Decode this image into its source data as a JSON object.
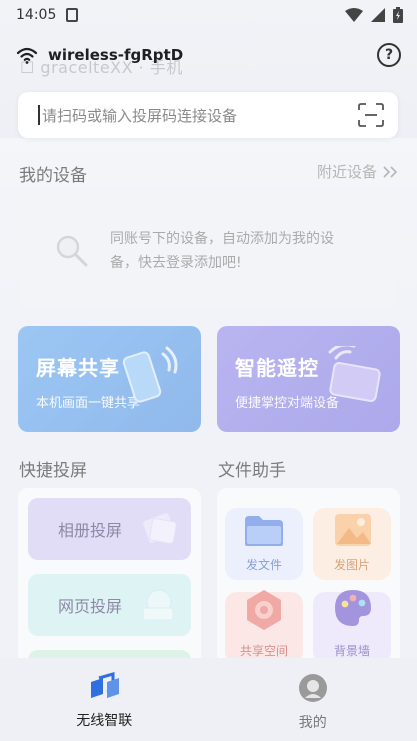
{
  "status_bar": {
    "time": "14:05"
  },
  "header": {
    "wifi_name": "wireless-fgRptD",
    "ghost_text": "☐ gracelteXX · 手机"
  },
  "search": {
    "placeholder": "请扫码或输入投屏码连接设备"
  },
  "my_devices": {
    "title": "我的设备",
    "nearby_label": "附近设备",
    "tip_line1": "同账号下的设备，自动添加为我的设备，",
    "tip_line2": "备，快去登录添加吧!"
  },
  "features": [
    {
      "title": "屏幕共享",
      "subtitle": "本机画面一键共享"
    },
    {
      "title": "智能遥控",
      "subtitle": "便捷掌控对端设备"
    }
  ],
  "quick_cast": {
    "title": "快捷投屏",
    "items": [
      "相册投屏",
      "网页投屏"
    ]
  },
  "file_assistant": {
    "title": "文件助手",
    "items": [
      "发文件",
      "发图片",
      "共享空间",
      "背景墙"
    ]
  },
  "bottom_nav": [
    {
      "label": "无线智联",
      "active": true
    },
    {
      "label": "我的",
      "active": false
    }
  ],
  "colors": {
    "screen_share": "#5fa4ec",
    "remote": "#8f88e8",
    "album_pill": "#c9c2ef",
    "web_pill": "#bfe6e8",
    "send_file": "#dfe6fb",
    "send_image": "#fbe3cf",
    "share_space": "#f8d6d4",
    "background_wall": "#e3dcf8",
    "active_nav": "#2f6fe0"
  }
}
